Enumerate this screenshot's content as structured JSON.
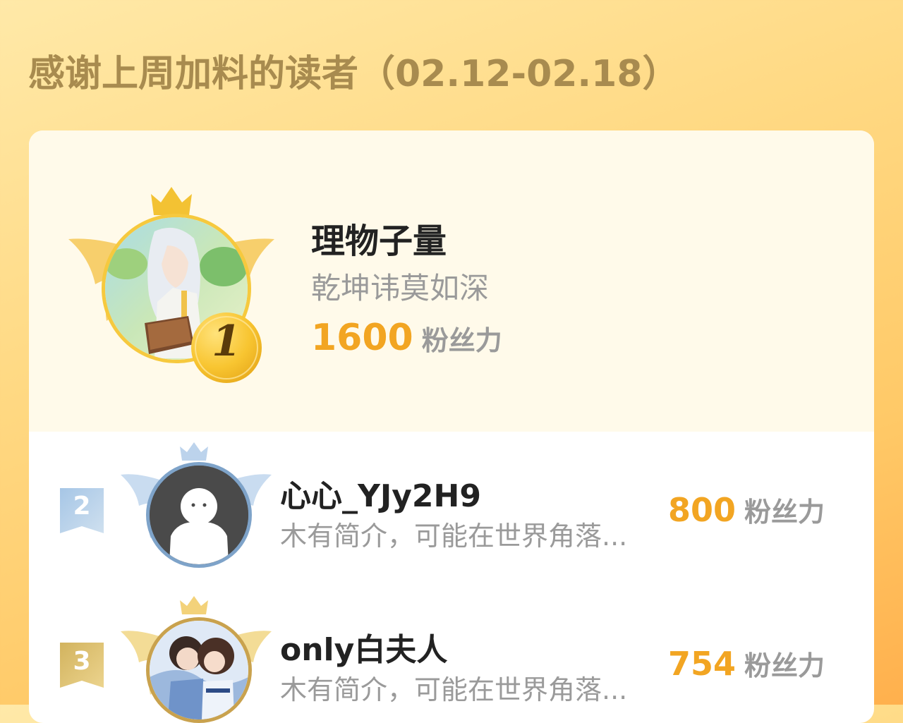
{
  "header": {
    "title": "感谢上周加料的读者（02.12-02.18）"
  },
  "colors": {
    "accent_gold": "#f2a522",
    "title_brown": "#a88b4f",
    "silver": "#aac4de",
    "bronze": "#d8bb6a"
  },
  "leaderboard": {
    "score_unit": "粉丝力",
    "first": {
      "rank_badge": "1",
      "name": "理物子量",
      "bio": "乾坤讳莫如深",
      "score": "1600"
    },
    "entries": [
      {
        "rank": "2",
        "name": "心心_YJy2H9",
        "bio": "木有简介，可能在世界角落...",
        "score": "800"
      },
      {
        "rank": "3",
        "name": "only白夫人",
        "bio": "木有简介，可能在世界角落...",
        "score": "754"
      }
    ]
  },
  "icons": {
    "first_crown": "crown-icon",
    "first_medal": "gold-medal-icon",
    "ribbon": "rank-ribbon-icon",
    "wings": "wings-icon"
  }
}
